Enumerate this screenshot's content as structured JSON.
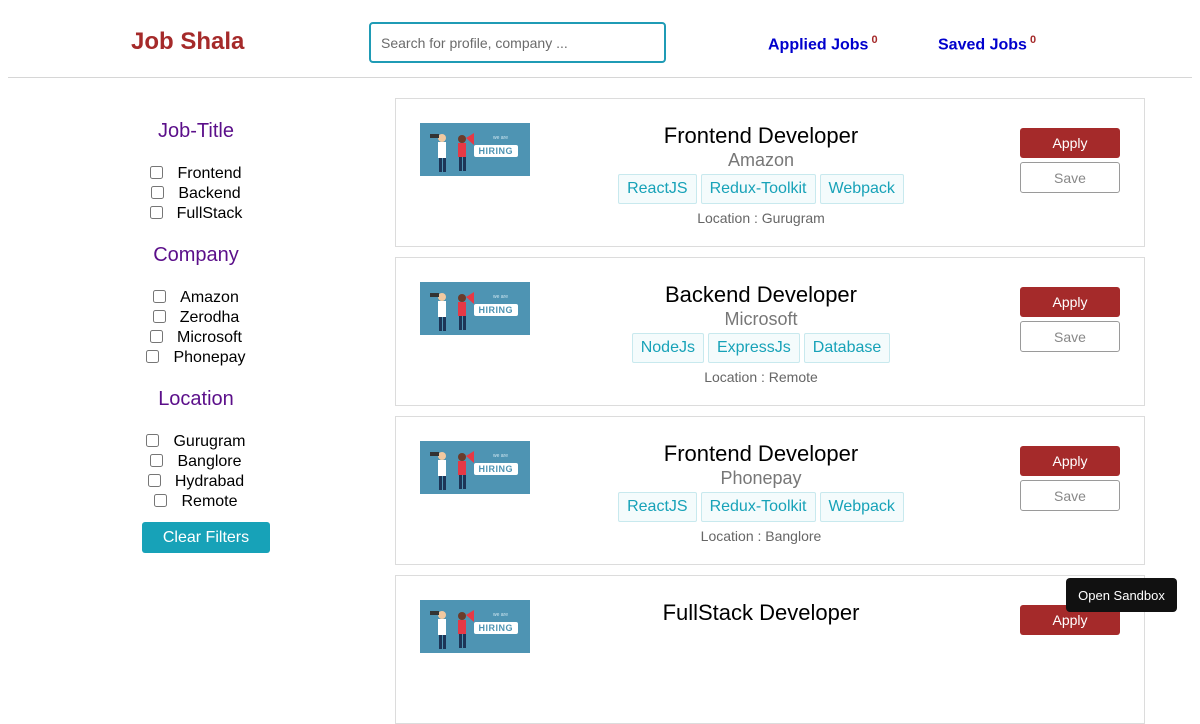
{
  "header": {
    "brand": "Job Shala",
    "search_placeholder": "Search for profile, company ...",
    "applied_label": "Applied Jobs",
    "applied_count": "0",
    "saved_label": "Saved Jobs",
    "saved_count": "0"
  },
  "filters": {
    "job_title": {
      "heading": "Job-Title",
      "options": [
        "Frontend",
        "Backend",
        "FullStack"
      ]
    },
    "company": {
      "heading": "Company",
      "options": [
        "Amazon",
        "Zerodha",
        "Microsoft",
        "Phonepay"
      ]
    },
    "location": {
      "heading": "Location",
      "options": [
        "Gurugram",
        "Banglore",
        "Hydrabad",
        "Remote"
      ]
    },
    "clear_label": "Clear Filters"
  },
  "jobs": [
    {
      "title": "Frontend Developer",
      "company": "Amazon",
      "tags": [
        "ReactJS",
        "Redux-Toolkit",
        "Webpack"
      ],
      "location": "Location : Gurugram",
      "apply_label": "Apply",
      "save_label": "Save"
    },
    {
      "title": "Backend Developer",
      "company": "Microsoft",
      "tags": [
        "NodeJs",
        "ExpressJs",
        "Database"
      ],
      "location": "Location : Remote",
      "apply_label": "Apply",
      "save_label": "Save"
    },
    {
      "title": "Frontend Developer",
      "company": "Phonepay",
      "tags": [
        "ReactJS",
        "Redux-Toolkit",
        "Webpack"
      ],
      "location": "Location : Banglore",
      "apply_label": "Apply",
      "save_label": "Save"
    },
    {
      "title": "FullStack Developer",
      "apply_label": "Apply"
    }
  ],
  "image_text": "HIRING",
  "sandbox_label": "Open Sandbox",
  "colors": {
    "brand": "#a52a2a",
    "nav_link": "#0000cd",
    "filter_heading": "#5b0f8a",
    "accent": "#17a2b8"
  }
}
